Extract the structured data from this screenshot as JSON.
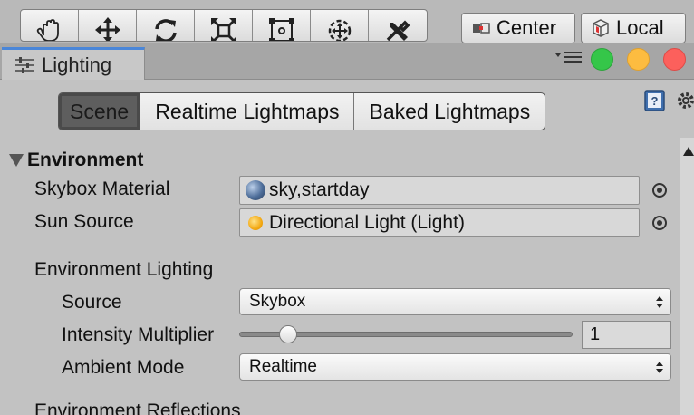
{
  "toolbar": {
    "tools": [
      {
        "icon": "hand-icon"
      },
      {
        "icon": "move-icon"
      },
      {
        "icon": "rotate-icon"
      },
      {
        "icon": "scale-icon"
      },
      {
        "icon": "rect-transform-icon"
      },
      {
        "icon": "transform-icon"
      },
      {
        "icon": "custom-tools-icon"
      }
    ],
    "pivot_mode_label": "Center",
    "pivot_rotation_label": "Local"
  },
  "window": {
    "tab_label": "Lighting",
    "tab_icon": "lighting-settings-icon",
    "traffic_colors": {
      "green": "#35c649",
      "yellow": "#fdbc40",
      "red": "#fc605c"
    },
    "accent": "#4a86d8"
  },
  "tabs": [
    {
      "label": "Scene",
      "active": true
    },
    {
      "label": "Realtime Lightmaps",
      "active": false
    },
    {
      "label": "Baked Lightmaps",
      "active": false
    }
  ],
  "environment": {
    "header": "Environment",
    "skybox_label": "Skybox Material",
    "skybox_value": "sky,startday",
    "sun_label": "Sun Source",
    "sun_value": "Directional Light (Light)",
    "lighting_header": "Environment Lighting",
    "source_label": "Source",
    "source_value": "Skybox",
    "intensity_label": "Intensity Multiplier",
    "intensity_value": "1",
    "intensity_fraction": 0.125,
    "ambient_label": "Ambient Mode",
    "ambient_value": "Realtime",
    "reflections_header": "Environment Reflections"
  }
}
